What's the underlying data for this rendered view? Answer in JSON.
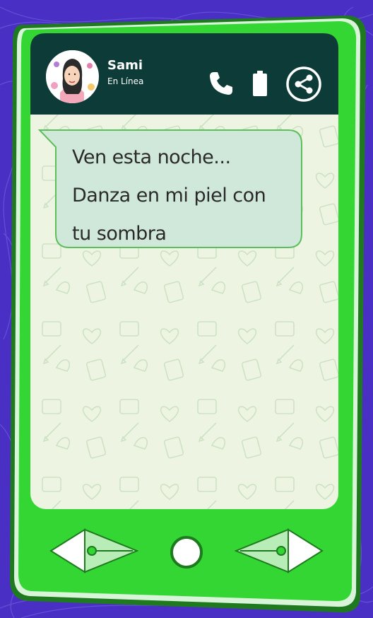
{
  "contact": {
    "name": "Sami",
    "status": "En Línea"
  },
  "message": {
    "lines": [
      "Ven esta noche...",
      "Danza en mi piel con",
      "tu sombra"
    ]
  },
  "icons": {
    "call": "phone-icon",
    "battery": "battery-icon",
    "share": "share-icon",
    "back": "left-arrow-icon",
    "home": "home-circle-icon",
    "forward": "right-arrow-icon"
  },
  "colors": {
    "background": "#4a2fc4",
    "phone_body": "#33d633",
    "header": "#0d3b37",
    "chat_bg": "#eef4e2",
    "bubble": "#d0e8da",
    "bubble_border": "#5cbf5c"
  }
}
